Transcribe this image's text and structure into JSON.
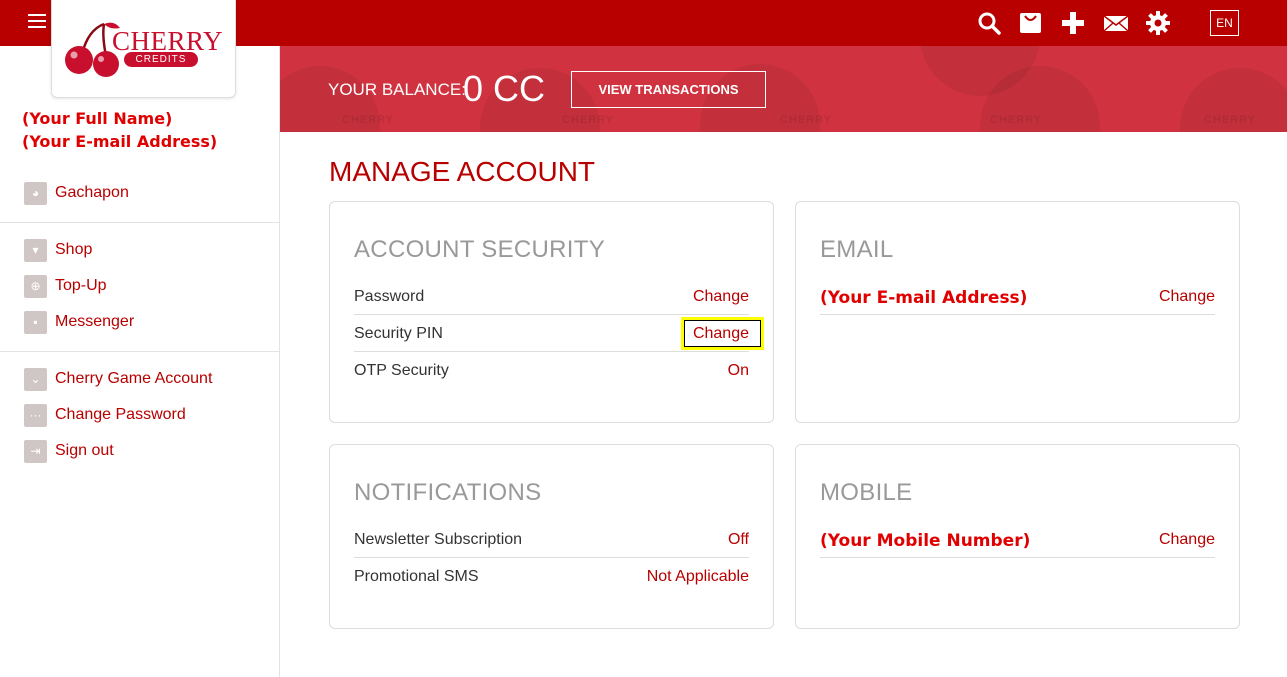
{
  "brand": {
    "name": "CHERRY",
    "sub": "CREDITS"
  },
  "header": {
    "lang": "EN"
  },
  "user": {
    "name": "(Your Full Name)",
    "email": "(Your E-mail Address)"
  },
  "sidebar": {
    "groups": [
      [
        {
          "label": "Gachapon",
          "icon": "gachapon-icon"
        }
      ],
      [
        {
          "label": "Shop",
          "icon": "shop-icon"
        },
        {
          "label": "Top-Up",
          "icon": "topup-icon"
        },
        {
          "label": "Messenger",
          "icon": "messenger-icon"
        }
      ],
      [
        {
          "label": "Cherry Game Account",
          "icon": "game-account-icon"
        },
        {
          "label": "Change Password",
          "icon": "password-icon"
        },
        {
          "label": "Sign out",
          "icon": "signout-icon"
        }
      ]
    ]
  },
  "banner": {
    "balance_label": "YOUR BALANCE:",
    "balance_value": "0 CC",
    "view_button": "VIEW TRANSACTIONS",
    "watermark": "CHERRY"
  },
  "main": {
    "title": "MANAGE ACCOUNT",
    "cards": {
      "security": {
        "title": "ACCOUNT SECURITY",
        "rows": [
          {
            "label": "Password",
            "value": "Change"
          },
          {
            "label": "Security PIN",
            "value": "Change"
          },
          {
            "label": "OTP Security",
            "value": "On"
          }
        ]
      },
      "email": {
        "title": "EMAIL",
        "rows": [
          {
            "label": "(Your E-mail Address)",
            "value": "Change"
          }
        ]
      },
      "notifications": {
        "title": "NOTIFICATIONS",
        "rows": [
          {
            "label": "Newsletter Subscription",
            "value": "Off"
          },
          {
            "label": "Promotional SMS",
            "value": "Not Applicable"
          }
        ]
      },
      "mobile": {
        "title": "MOBILE",
        "rows": [
          {
            "label": "(Your Mobile Number)",
            "value": "Change"
          }
        ]
      }
    }
  },
  "colors": {
    "brand_red": "#b80000",
    "banner_red": "#d0333f",
    "highlight": "#ffff00",
    "placeholder_red": "#e00000"
  }
}
